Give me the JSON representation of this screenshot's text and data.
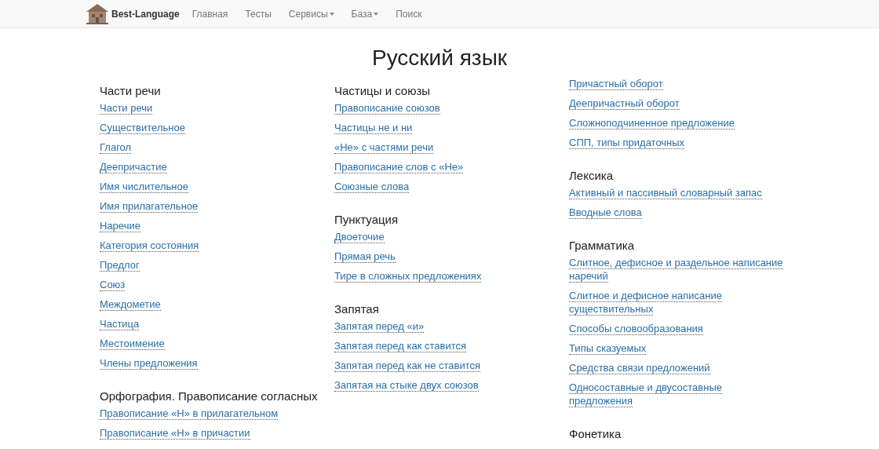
{
  "navbar": {
    "brand": "Best-Language",
    "items": [
      {
        "label": "Главная",
        "dropdown": false
      },
      {
        "label": "Тесты",
        "dropdown": false
      },
      {
        "label": "Сервисы",
        "dropdown": true
      },
      {
        "label": "База",
        "dropdown": true
      },
      {
        "label": "Поиск",
        "dropdown": false
      }
    ]
  },
  "title": "Русский язык",
  "columns": [
    {
      "sections": [
        {
          "heading": "Части речи",
          "links": [
            "Части речи",
            "Существительное",
            "Глагол",
            "Деепричастие",
            "Имя числительное",
            "Имя прилагательное",
            "Наречие",
            "Категория состояния",
            "Предлог",
            "Союз",
            "Междометие",
            "Частица",
            "Местоимение",
            "Члены предложения"
          ]
        },
        {
          "heading": "Орфография. Правописание согласных",
          "links": [
            "Правописание «Н» в прилагательном",
            "Правописание «Н» в причастии"
          ]
        }
      ]
    },
    {
      "sections": [
        {
          "heading": "Частицы и союзы",
          "links": [
            "Правописание союзов",
            "Частицы не и ни",
            "«Не» с частями речи",
            "Правописание слов с «Не»",
            "Союзные слова"
          ]
        },
        {
          "heading": "Пунктуация",
          "links": [
            "Двоеточие",
            "Прямая речь",
            "Тире в сложных предложениях"
          ]
        },
        {
          "heading": "Запятая",
          "links": [
            "Запятая перед «и»",
            "Запятая перед как ставится",
            "Запятая перед как не ставится",
            "Запятая на стыке двух союзов"
          ]
        }
      ]
    },
    {
      "sections": [
        {
          "links": [
            "Причастный оборот",
            "Деепричастный оборот",
            "Сложноподчиненное предложение",
            "СПП, типы придаточных"
          ]
        },
        {
          "heading": "Лексика",
          "links": [
            "Активный и пассивный словарный запас",
            "Вводные слова"
          ]
        },
        {
          "heading": "Грамматика",
          "links": [
            "Слитное, дефисное и раздельное написание наречий",
            "Слитное и дефисное написание существительных",
            "Способы словообразования",
            "Типы сказуемых",
            "Средства связи предложений",
            "Односоставные и двусоставные предложения"
          ]
        },
        {
          "heading": "Фонетика"
        }
      ]
    }
  ]
}
